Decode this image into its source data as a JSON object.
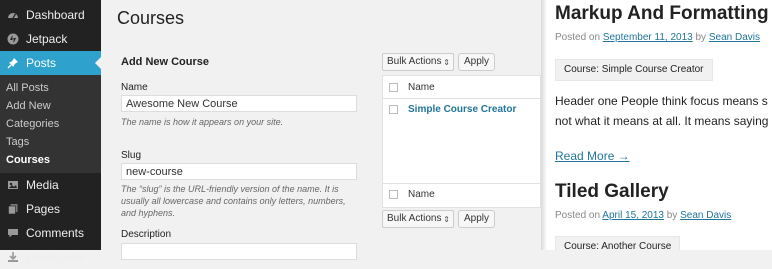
{
  "sidebar": {
    "menu": [
      {
        "label": "Dashboard",
        "icon": "dashboard-icon"
      },
      {
        "label": "Jetpack",
        "icon": "jetpack-icon"
      },
      {
        "label": "Posts",
        "icon": "pin-icon"
      }
    ],
    "submenu": [
      "All Posts",
      "Add New",
      "Categories",
      "Tags",
      "Courses"
    ],
    "menu_after": [
      {
        "label": "Media",
        "icon": "media-icon"
      },
      {
        "label": "Pages",
        "icon": "pages-icon"
      },
      {
        "label": "Comments",
        "icon": "comments-icon"
      },
      {
        "label": "Downloads",
        "icon": "downloads-icon"
      }
    ]
  },
  "main": {
    "title": "Courses",
    "form": {
      "heading": "Add New Course",
      "name_label": "Name",
      "name_value": "Awesome New Course",
      "name_desc": "The name is how it appears on your site.",
      "slug_label": "Slug",
      "slug_value": "new-course",
      "slug_desc": "The “slug” is the URL-friendly version of the name. It is usually all lowercase and contains only letters, numbers, and hyphens.",
      "desc_label": "Description"
    },
    "bulk_actions_label": "Bulk Actions",
    "apply_label": "Apply",
    "table": {
      "header": "Name",
      "rows": [
        "Simple Course Creator"
      ],
      "footer": "Name"
    }
  },
  "preview": {
    "posts": [
      {
        "title": "Markup And Formatting",
        "posted_on": "Posted on",
        "date": "September 11, 2013",
        "by": "by",
        "author": "Sean Davis",
        "tag": "Course: Simple Course Creator",
        "body_lines": [
          "Header one People think focus means s",
          "not what it means at all. It means saying"
        ],
        "read_more": "Read More →"
      },
      {
        "title": "Tiled Gallery",
        "posted_on": "Posted on",
        "date": "April 15, 2013",
        "by": "by",
        "author": "Sean Davis",
        "tag": "Course: Another Course"
      }
    ]
  },
  "colors": {
    "accent": "#2ea2cc",
    "link": "#21759b",
    "sidebar_bg": "#222222"
  }
}
